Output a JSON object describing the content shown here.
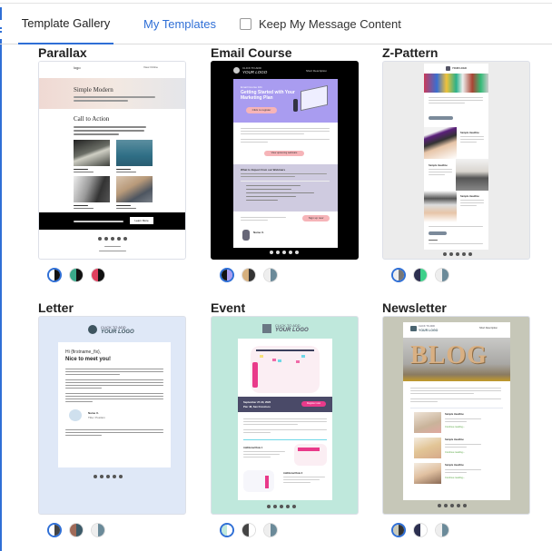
{
  "tabs": {
    "gallery": "Template Gallery",
    "mine": "My Templates",
    "active": "Template Gallery"
  },
  "keep_content": {
    "label": "Keep My Message Content",
    "checked": false
  },
  "templates": [
    {
      "name": "Parallax",
      "preview": {
        "logo": "logo",
        "link": "View Online",
        "hero_title": "Simple Modern",
        "section_title": "Call to Action",
        "cta": "Learn More"
      },
      "swatches": [
        {
          "colors": [
            "#ffffff",
            "#111111"
          ],
          "selected": true
        },
        {
          "colors": [
            "#3aa98a",
            "#111111"
          ],
          "selected": false
        },
        {
          "colors": [
            "#e0405e",
            "#111111"
          ],
          "selected": false
        }
      ]
    },
    {
      "name": "Email Course",
      "preview": {
        "logo_line1": "CLICK TO ADD",
        "logo_line2": "YOUR LOGO",
        "short_desc": "Short Description",
        "kicker": "Email Course 101",
        "title": "Getting Started with Your Marketing Plan",
        "cta1": "Click to register",
        "cta2": "View upcoming webinars",
        "section": "What to Expect from our Webinars",
        "cta3": "Sign up now",
        "signer": "Name X."
      },
      "swatches": [
        {
          "colors": [
            "#111111",
            "#a99cf0"
          ],
          "selected": true
        },
        {
          "colors": [
            "#d6b07e",
            "#333333"
          ],
          "selected": false
        },
        {
          "colors": [
            "#eeeeee",
            "#6b8a99"
          ],
          "selected": false
        }
      ]
    },
    {
      "name": "Z-Pattern",
      "preview": {
        "logo": "YOUR LOGO",
        "headline": "Sample Headline"
      },
      "swatches": [
        {
          "colors": [
            "#eeeeee",
            "#777777"
          ],
          "selected": true
        },
        {
          "colors": [
            "#2c3050",
            "#3ed08a"
          ],
          "selected": false
        },
        {
          "colors": [
            "#eeeeee",
            "#6b8a99"
          ],
          "selected": false
        }
      ]
    },
    {
      "name": "Letter",
      "preview": {
        "logo_line1": "CLICK TO ADD",
        "logo_line2": "YOUR LOGO",
        "greeting": "Hi {firstname_fix},",
        "title": "Nice to meet you!",
        "signer": "Name X.",
        "signer_title": "Title / Position"
      },
      "swatches": [
        {
          "colors": [
            "#ffffff",
            "#444444"
          ],
          "selected": true
        },
        {
          "colors": [
            "#a06a58",
            "#3c5a68"
          ],
          "selected": false
        },
        {
          "colors": [
            "#eeeeee",
            "#6b8a99"
          ],
          "selected": false
        }
      ]
    },
    {
      "name": "Event",
      "preview": {
        "logo_line1": "CLICK TO ADD",
        "logo_line2": "YOUR LOGO",
        "date": "September 27-30, 2020",
        "place": "Pier 48, San Francisco",
        "cta": "Register now",
        "extra1": "Additional Date 1",
        "extra2": "Additional Date 2"
      },
      "swatches": [
        {
          "colors": [
            "#bfe8dc",
            "#ffffff"
          ],
          "selected": true
        },
        {
          "colors": [
            "#444444",
            "#ffffff"
          ],
          "selected": false
        },
        {
          "colors": [
            "#eeeeee",
            "#6b8a99"
          ],
          "selected": false
        }
      ]
    },
    {
      "name": "Newsletter",
      "preview": {
        "logo_line1": "CLICK TO ADD",
        "logo_line2": "YOUR LOGO",
        "short_desc": "Short Description",
        "hero": "BLOG",
        "headline": "Sample Headline",
        "read_more": "Continue reading ›"
      },
      "swatches": [
        {
          "colors": [
            "#c8c9b9",
            "#333333"
          ],
          "selected": true
        },
        {
          "colors": [
            "#2c3050",
            "#ffffff"
          ],
          "selected": false
        },
        {
          "colors": [
            "#eeeeee",
            "#6b8a99"
          ],
          "selected": false
        }
      ]
    }
  ],
  "colors": {
    "accent": "#2f6fd6",
    "parallax_bg": "#ffffff",
    "email_course_bg": "#000000",
    "zpattern_bg": "#ececec",
    "letter_bg": "#dfe8f7",
    "event_bg": "#bfe8dc",
    "newsletter_bg": "#c6c7b8"
  }
}
